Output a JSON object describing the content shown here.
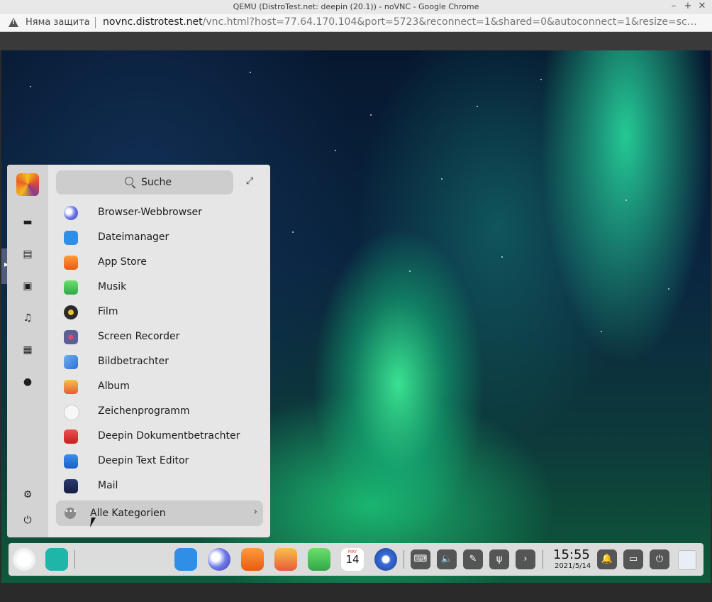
{
  "window": {
    "title": "QEMU (DistroTest.net: deepin (20.1)) - noVNC - Google Chrome",
    "controls": [
      "–",
      "+",
      "✕"
    ]
  },
  "addressbar": {
    "security_label": "Няма защита",
    "url_host": "novnc.distrotest.net",
    "url_path": "/vnc.html?host=77.64.170.104&port=5723&reconnect=1&shared=0&autoconnect=1&resize=scale&recon..."
  },
  "launcher": {
    "search_label": "Suche",
    "categories": [
      {
        "icon": "monitor-icon",
        "glyph": "▬"
      },
      {
        "icon": "document-icon",
        "glyph": "▤"
      },
      {
        "icon": "image-icon",
        "glyph": "▣"
      },
      {
        "icon": "music-icon",
        "glyph": "♫"
      },
      {
        "icon": "film-icon",
        "glyph": "▦"
      },
      {
        "icon": "others-icon",
        "glyph": "●"
      }
    ],
    "apps": [
      {
        "name": "Browser-Webbrowser",
        "icon": "browser-icon",
        "color": "#5b6bd8"
      },
      {
        "name": "Dateimanager",
        "icon": "file-manager-icon",
        "color": "#2f8fe6"
      },
      {
        "name": "App Store",
        "icon": "app-store-icon",
        "color": "#f07a1e"
      },
      {
        "name": "Musik",
        "icon": "music-app-icon",
        "color": "#49c25b"
      },
      {
        "name": "Film",
        "icon": "film-app-icon",
        "color": "#2a2a2a"
      },
      {
        "name": "Screen Recorder",
        "icon": "screen-recorder-icon",
        "color": "#6a6fa8"
      },
      {
        "name": "Bildbetrachter",
        "icon": "image-viewer-icon",
        "color": "#3c7ed8"
      },
      {
        "name": "Album",
        "icon": "album-icon",
        "color": "#f09040"
      },
      {
        "name": "Zeichenprogramm",
        "icon": "draw-icon",
        "color": "#f4f4f4"
      },
      {
        "name": "Deepin Dokumentbetrachter",
        "icon": "document-viewer-icon",
        "color": "#d83a3a"
      },
      {
        "name": "Deepin Text Editor",
        "icon": "text-editor-icon",
        "color": "#1f6fd1"
      },
      {
        "name": "Mail",
        "icon": "mail-icon",
        "color": "#1d2a55"
      }
    ],
    "all_categories_label": "Alle Kategorien"
  },
  "dock": {
    "time": "15:55",
    "date": "2021/5/14",
    "calendar_month": "MAY",
    "calendar_day": "14"
  }
}
